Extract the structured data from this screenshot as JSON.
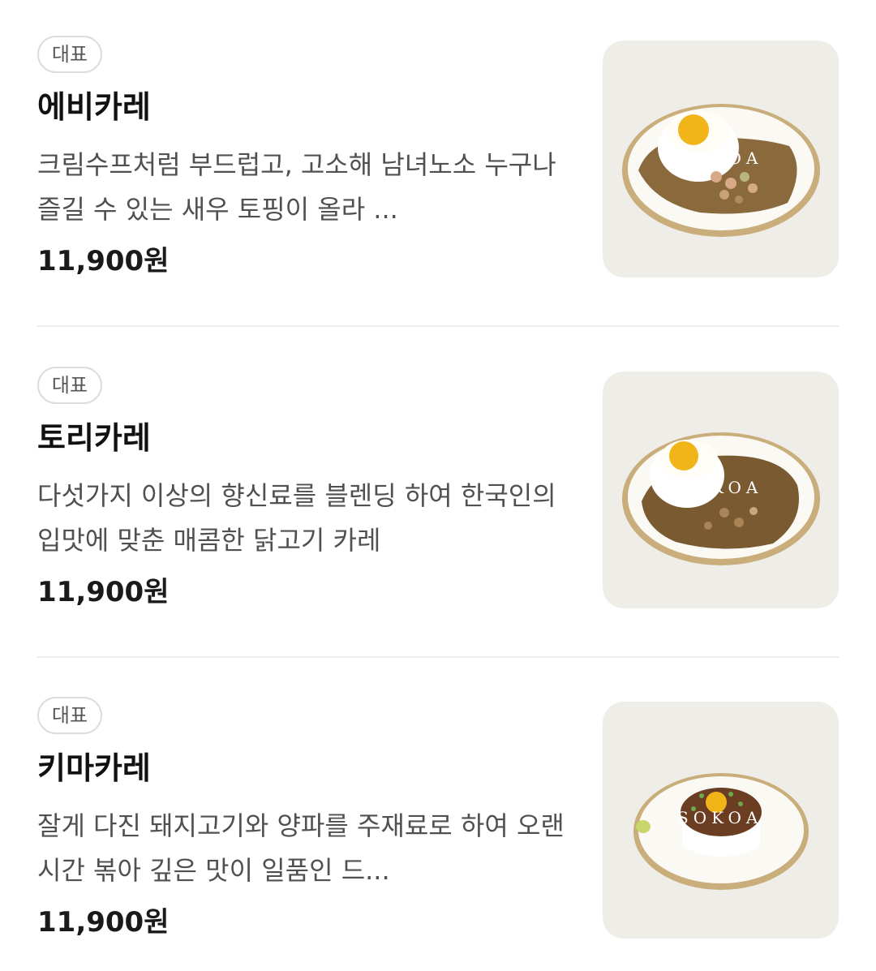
{
  "menu": {
    "items": [
      {
        "badge": "대표",
        "name": "에비카레",
        "description": "크림수프처럼 부드럽고, 고소해 남녀노소 누구나 즐길 수 있는 새우 토핑이 올라 ...",
        "price": "11,900원",
        "image_watermark": "SOKOA"
      },
      {
        "badge": "대표",
        "name": "토리카레",
        "description": "다섯가지 이상의 향신료를 블렌딩 하여 한국인의 입맛에 맞춘 매콤한 닭고기 카레",
        "price": "11,900원",
        "image_watermark": "SOKOA"
      },
      {
        "badge": "대표",
        "name": "키마카레",
        "description": "잘게 다진 돼지고기와 양파를 주재료로 하여 오랜 시간 볶아 깊은 맛이 일품인 드...",
        "price": "11,900원",
        "image_watermark": "SOKOA"
      }
    ]
  },
  "colors": {
    "background": "#ffffff",
    "thumbnail_bg": "#efede8",
    "badge_border": "#dcdcdc",
    "divider": "#efefef",
    "curry": "#8a6a3c",
    "egg_yolk": "#f2b517",
    "plate_rim": "#c9ae7c"
  }
}
